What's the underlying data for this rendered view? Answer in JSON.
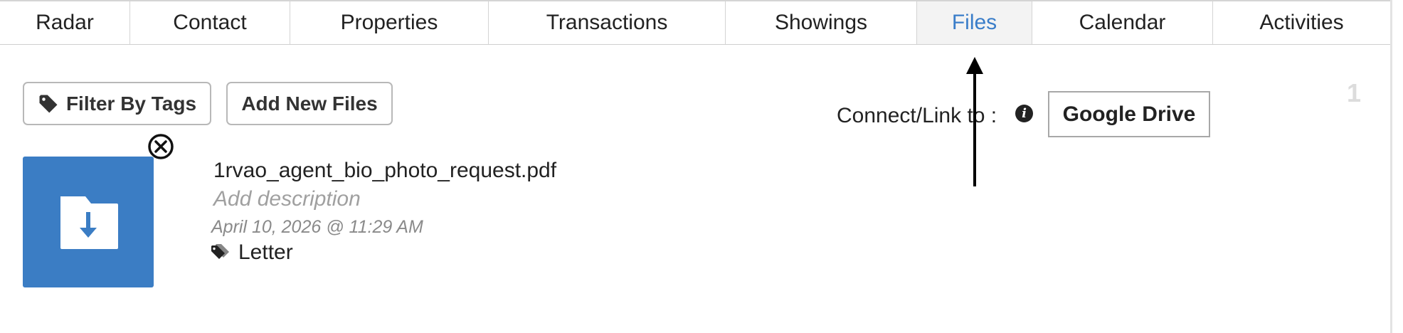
{
  "tabs": [
    {
      "label": "Radar",
      "active": false
    },
    {
      "label": "Contact",
      "active": false
    },
    {
      "label": "Properties",
      "active": false
    },
    {
      "label": "Transactions",
      "active": false
    },
    {
      "label": "Showings",
      "active": false
    },
    {
      "label": "Files",
      "active": true
    },
    {
      "label": "Calendar",
      "active": false
    },
    {
      "label": "Activities",
      "active": false
    }
  ],
  "toolbar": {
    "filter_label": "Filter By Tags",
    "add_label": "Add New Files"
  },
  "connect": {
    "label": "Connect/Link to :",
    "service_button": "Google Drive"
  },
  "pagination": {
    "current": "1"
  },
  "files": [
    {
      "name": "1rvao_agent_bio_photo_request.pdf",
      "description_placeholder": "Add description",
      "date": "April 10, 2026 @ 11:29 AM",
      "tag": "Letter"
    }
  ],
  "colors": {
    "accent": "#3a7dc9",
    "thumbnail": "#3b7dc4",
    "active_tab_bg": "#f3f3f3"
  },
  "icons": [
    "tag-icon",
    "info-icon",
    "folder-download-icon",
    "close-circle-icon",
    "annotation-arrow"
  ]
}
